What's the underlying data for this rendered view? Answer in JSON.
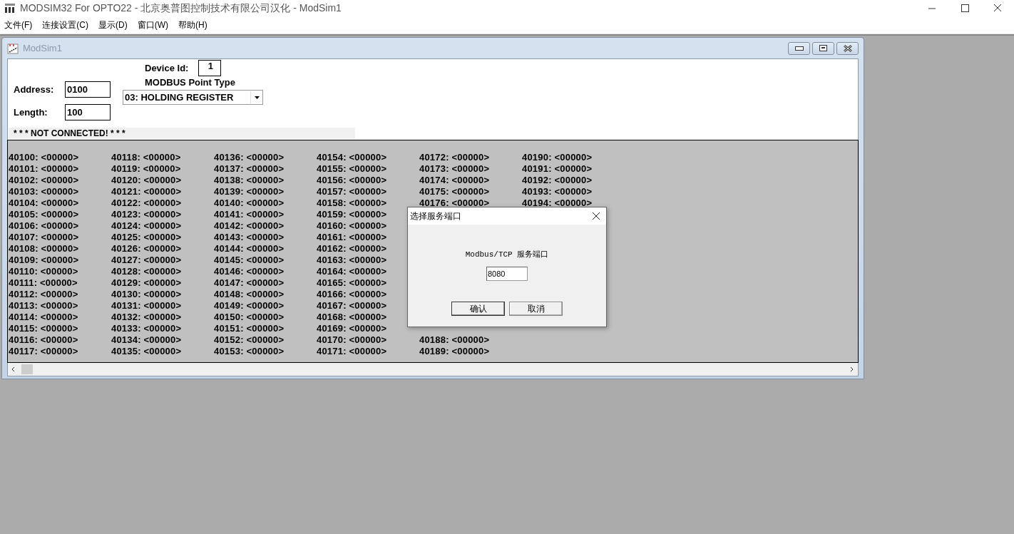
{
  "app": {
    "title": "MODSIM32 For OPTO22 - 北京奥普图控制技术有限公司汉化 - ModSim1"
  },
  "menu": [
    {
      "label": "文件(F)"
    },
    {
      "label": "连接设置(C)"
    },
    {
      "label": "显示(D)"
    },
    {
      "label": "窗口(W)"
    },
    {
      "label": "帮助(H)"
    }
  ],
  "child_window": {
    "title": "ModSim1"
  },
  "form": {
    "device_id_label": "Device Id:",
    "device_id": "1",
    "address_label": "Address:",
    "address": "0100",
    "length_label": "Length:",
    "length": "100",
    "point_type_label": "MODBUS Point Type",
    "point_type": "03: HOLDING REGISTER",
    "status": "* * * NOT CONNECTED! * * *"
  },
  "registers": {
    "columns": [
      {
        "cells": [
          "40100: <00000>",
          "40101: <00000>",
          "40102: <00000>",
          "40103: <00000>",
          "40104: <00000>",
          "40105: <00000>",
          "40106: <00000>",
          "40107: <00000>",
          "40108: <00000>",
          "40109: <00000>",
          "40110: <00000>",
          "40111: <00000>",
          "40112: <00000>",
          "40113: <00000>",
          "40114: <00000>",
          "40115: <00000>",
          "40116: <00000>",
          "40117: <00000>"
        ]
      },
      {
        "cells": [
          "40118: <00000>",
          "40119: <00000>",
          "40120: <00000>",
          "40121: <00000>",
          "40122: <00000>",
          "40123: <00000>",
          "40124: <00000>",
          "40125: <00000>",
          "40126: <00000>",
          "40127: <00000>",
          "40128: <00000>",
          "40129: <00000>",
          "40130: <00000>",
          "40131: <00000>",
          "40132: <00000>",
          "40133: <00000>",
          "40134: <00000>",
          "40135: <00000>"
        ]
      },
      {
        "cells": [
          "40136: <00000>",
          "40137: <00000>",
          "40138: <00000>",
          "40139: <00000>",
          "40140: <00000>",
          "40141: <00000>",
          "40142: <00000>",
          "40143: <00000>",
          "40144: <00000>",
          "40145: <00000>",
          "40146: <00000>",
          "40147: <00000>",
          "40148: <00000>",
          "40149: <00000>",
          "40150: <00000>",
          "40151: <00000>",
          "40152: <00000>",
          "40153: <00000>"
        ]
      },
      {
        "cells": [
          "40154: <00000>",
          "40155: <00000>",
          "40156: <00000>",
          "40157: <00000>",
          "40158: <00000>",
          "40159: <00000>",
          "40160: <00000>",
          "40161: <00000>",
          "40162: <00000>",
          "40163: <00000>",
          "40164: <00000>",
          "40165: <00000>",
          "40166: <00000>",
          "40167: <00000>",
          "40168: <00000>",
          "40169: <00000>",
          "40170: <00000>",
          "40171: <00000>"
        ]
      },
      {
        "cells": [
          "40172: <00000>",
          "40173: <00000>",
          "40174: <00000>",
          "40175: <00000>",
          "40176: <00000>"
        ],
        "bottom_cells": [
          "40188: <00000>",
          "40189: <00000>"
        ]
      },
      {
        "cells": [
          "40190: <00000>",
          "40191: <00000>",
          "40192: <00000>",
          "40193: <00000>",
          "40194: <00000>"
        ]
      }
    ]
  },
  "dialog": {
    "title": "选择服务端口",
    "label": "Modbus/TCP 服务端口",
    "port": "8080",
    "buttons": [
      {
        "label": "确认",
        "kind": "ok"
      },
      {
        "label": "取消",
        "kind": "cancel"
      }
    ]
  }
}
